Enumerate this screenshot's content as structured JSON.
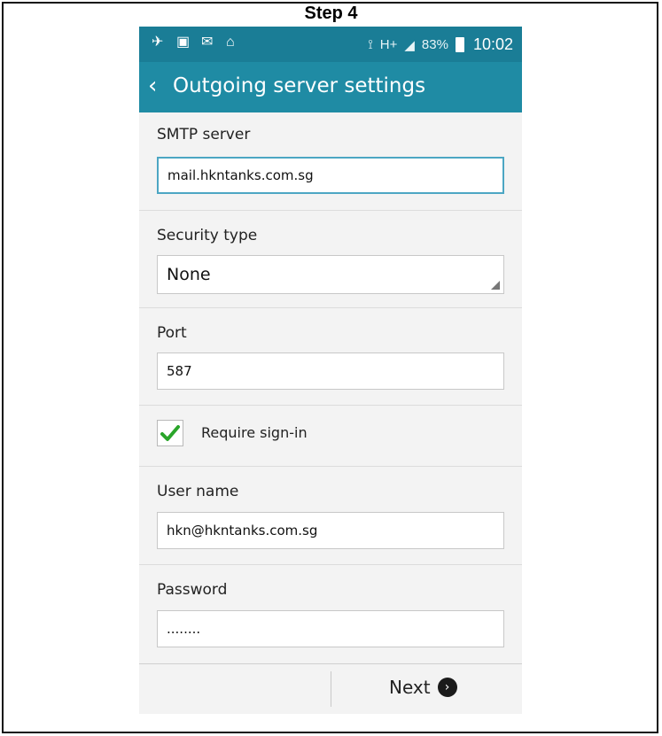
{
  "page": {
    "step_title": "Step 4"
  },
  "statusbar": {
    "icons_left": [
      "notification-icon-1",
      "notification-icon-2",
      "notification-icon-3",
      "notification-icon-4"
    ],
    "network_text": "H+",
    "battery_text": "83%",
    "time": "10:02"
  },
  "appbar": {
    "back_icon": "back-icon",
    "title": "Outgoing server settings"
  },
  "form": {
    "smtp_label": "SMTP server",
    "smtp_value": "mail.hkntanks.com.sg",
    "security_label": "Security type",
    "security_value": "None",
    "port_label": "Port",
    "port_value": "587",
    "require_signin_label": "Require sign-in",
    "require_signin_checked": true,
    "username_label": "User name",
    "username_value": "hkn@hkntanks.com.sg",
    "password_label": "Password",
    "password_value": "........"
  },
  "footer": {
    "next_label": "Next"
  },
  "colors": {
    "statusbar": "#1a7d96",
    "appbar": "#1f8ba4",
    "checkbox_check": "#2aa52a",
    "focus": "#4ca6c3"
  }
}
